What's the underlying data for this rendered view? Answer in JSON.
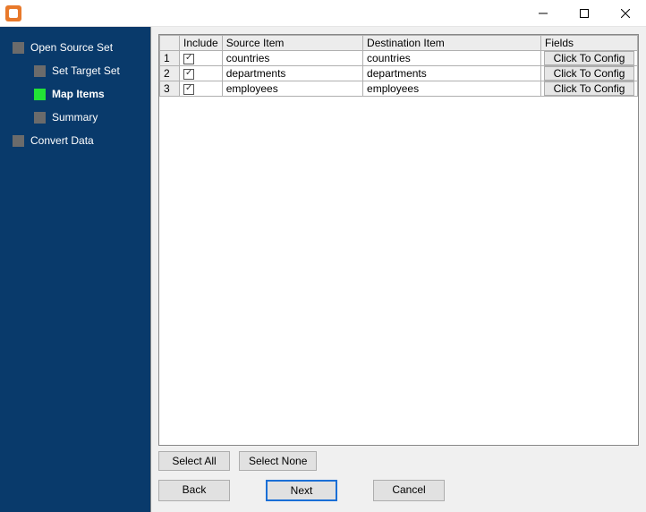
{
  "window": {
    "title": ""
  },
  "sidebar": {
    "items": [
      {
        "label": "Open Source Set",
        "child": false,
        "active": false
      },
      {
        "label": "Set Target Set",
        "child": true,
        "active": false
      },
      {
        "label": "Map Items",
        "child": true,
        "active": true
      },
      {
        "label": "Summary",
        "child": true,
        "active": false
      },
      {
        "label": "Convert Data",
        "child": false,
        "active": false
      }
    ]
  },
  "grid": {
    "headers": {
      "include": "Include",
      "source": "Source Item",
      "dest": "Destination Item",
      "fields": "Fields"
    },
    "config_label": "Click To Config",
    "rows": [
      {
        "num": "1",
        "include": true,
        "source": "countries",
        "dest": "countries"
      },
      {
        "num": "2",
        "include": true,
        "source": "departments",
        "dest": "departments"
      },
      {
        "num": "3",
        "include": true,
        "source": "employees",
        "dest": "employees"
      }
    ]
  },
  "buttons": {
    "select_all": "Select All",
    "select_none": "Select None",
    "back": "Back",
    "next": "Next",
    "cancel": "Cancel"
  }
}
